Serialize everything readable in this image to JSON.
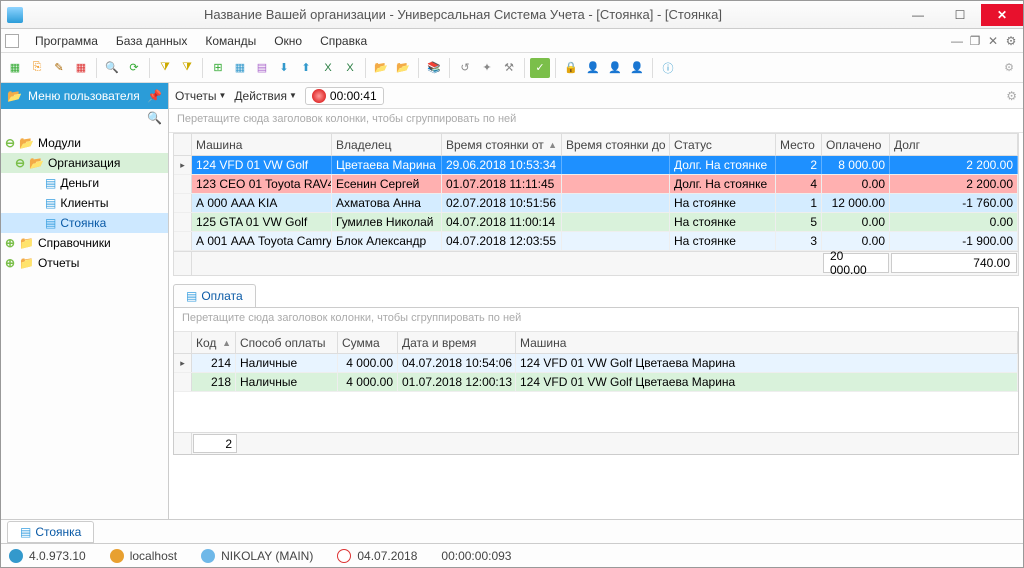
{
  "window": {
    "title": "Название Вашей организации - Универсальная Система Учета - [Стоянка] - [Стоянка]"
  },
  "menu": {
    "program": "Программа",
    "database": "База данных",
    "commands": "Команды",
    "window": "Окно",
    "help": "Справка"
  },
  "sidebar": {
    "title": "Меню пользователя",
    "nodes": {
      "modules": "Модули",
      "organization": "Организация",
      "money": "Деньги",
      "clients": "Клиенты",
      "parking": "Стоянка",
      "refs": "Справочники",
      "reports": "Отчеты"
    }
  },
  "subbar": {
    "reports": "Отчеты",
    "actions": "Действия",
    "timer": "00:00:41"
  },
  "groupHint": "Перетащите сюда заголовок колонки, чтобы сгруппировать по ней",
  "grid": {
    "headers": {
      "car": "Машина",
      "owner": "Владелец",
      "from": "Время стоянки от",
      "to": "Время стоянки до",
      "status": "Статус",
      "place": "Место",
      "paid": "Оплачено",
      "debt": "Долг"
    },
    "rows": [
      {
        "car": "124 VFD 01 VW Golf",
        "owner": "Цветаева Марина",
        "from": "29.06.2018 10:53:34",
        "to": "",
        "status": "Долг. На стоянке",
        "place": "2",
        "paid": "8 000.00",
        "debt": "2 200.00",
        "cls": "row-sel"
      },
      {
        "car": "123 CEO 01 Toyota RAV4",
        "owner": "Есенин Сергей",
        "from": "01.07.2018 11:11:45",
        "to": "",
        "status": "Долг. На стоянке",
        "place": "4",
        "paid": "0.00",
        "debt": "2 200.00",
        "cls": "row-red"
      },
      {
        "car": "А 000 ААА KIA",
        "owner": "Ахматова Анна",
        "from": "02.07.2018 10:51:56",
        "to": "",
        "status": "На стоянке",
        "place": "1",
        "paid": "12 000.00",
        "debt": "-1 760.00",
        "cls": "row-blue"
      },
      {
        "car": "125 GTA 01 VW Golf",
        "owner": "Гумилев Николай",
        "from": "04.07.2018 11:00:14",
        "to": "",
        "status": "На стоянке",
        "place": "5",
        "paid": "0.00",
        "debt": "0.00",
        "cls": "row-green"
      },
      {
        "car": "А 001 ААА Toyota Camry",
        "owner": "Блок Александр",
        "from": "04.07.2018 12:03:55",
        "to": "",
        "status": "На стоянке",
        "place": "3",
        "paid": "0.00",
        "debt": "-1 900.00",
        "cls": "row-lblue"
      }
    ],
    "totals": {
      "paid": "20 000.00",
      "debt": "740.00"
    }
  },
  "payTab": {
    "label": "Оплата",
    "headers": {
      "code": "Код",
      "method": "Способ оплаты",
      "sum": "Сумма",
      "datetime": "Дата и время",
      "car": "Машина"
    },
    "rows": [
      {
        "code": "214",
        "method": "Наличные",
        "sum": "4 000.00",
        "dt": "04.07.2018 10:54:06",
        "car": "124 VFD 01 VW Golf Цветаева Марина"
      },
      {
        "code": "218",
        "method": "Наличные",
        "sum": "4 000.00",
        "dt": "01.07.2018 12:00:13",
        "car": "124 VFD 01 VW Golf Цветаева Марина"
      }
    ],
    "count": "2"
  },
  "doctab": "Стоянка",
  "status": {
    "version": "4.0.973.10",
    "host": "localhost",
    "user": "NIKOLAY (MAIN)",
    "date": "04.07.2018",
    "elapsed": "00:00:00:093"
  }
}
